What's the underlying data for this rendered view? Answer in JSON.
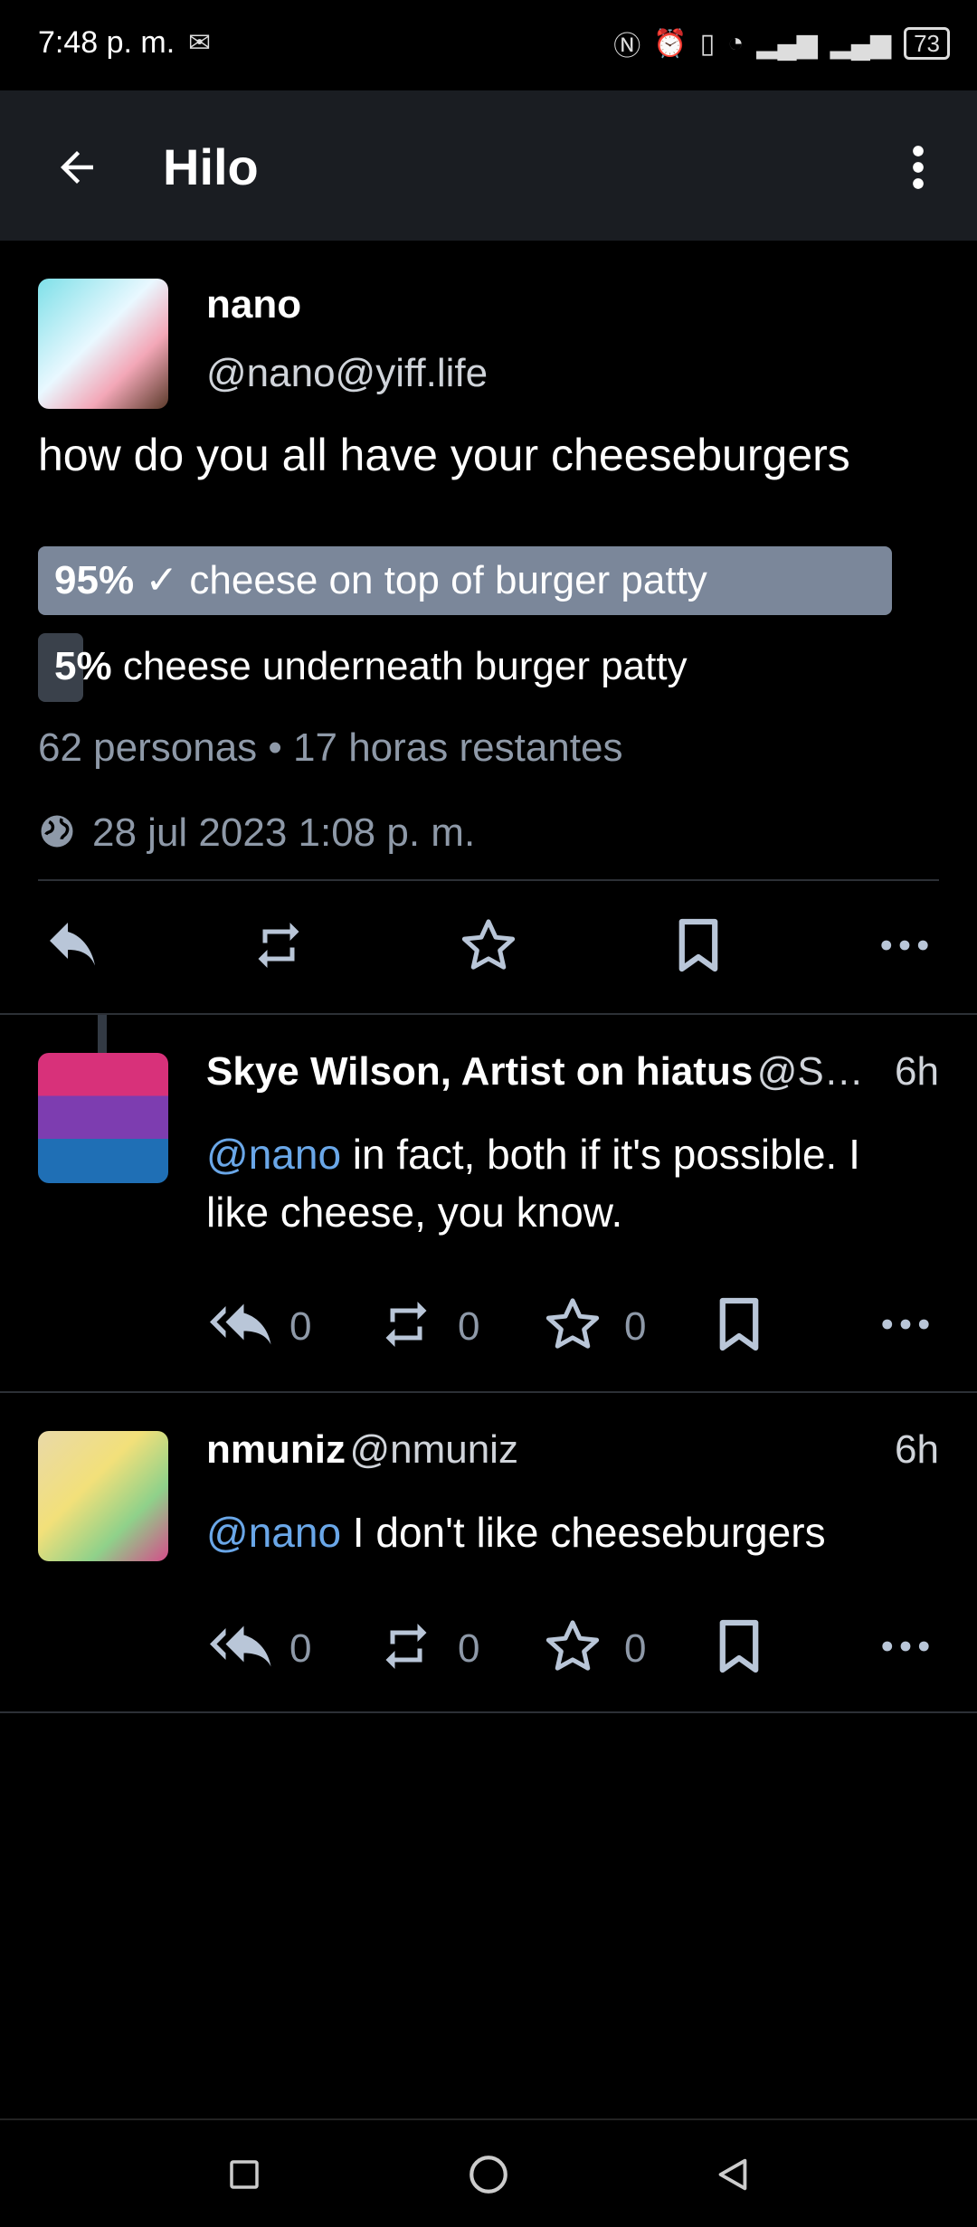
{
  "status_bar": {
    "time": "7:48 p. m.",
    "battery": "73"
  },
  "app_bar": {
    "title": "Hilo"
  },
  "post": {
    "author_name": "nano",
    "author_handle": "@nano@yiff.life",
    "content": "how do you all have your cheeseburgers",
    "poll": {
      "options": [
        {
          "percent": "95%",
          "check": "✓",
          "label": "cheese on top of burger patty",
          "fraction": 0.95,
          "voted": true
        },
        {
          "percent": "5%",
          "check": "",
          "label": "cheese underneath burger patty",
          "fraction": 0.05,
          "voted": false
        }
      ],
      "summary": "62 personas • 17 horas restantes"
    },
    "timestamp": "28 jul 2023 1:08 p. m."
  },
  "replies": [
    {
      "author_name": "Skye Wilson, Artist on hiatus",
      "author_handle": "@S…",
      "time": "6h",
      "mention": "@nano",
      "text_line1": " in fact, both if it's possible. I",
      "text_line2": "like cheese, you know.",
      "replies_count": "0",
      "boosts_count": "0",
      "favs_count": "0"
    },
    {
      "author_name": "nmuniz",
      "author_handle": "@nmuniz",
      "time": "6h",
      "mention": "@nano",
      "text_line1": " I don't like cheeseburgers",
      "replies_count": "0",
      "boosts_count": "0",
      "favs_count": "0"
    }
  ],
  "colors": {
    "accent": "#6aa7e8",
    "poll_voted": "#7b879a",
    "poll_other": "#3a414b",
    "muted": "#8e99a8"
  }
}
